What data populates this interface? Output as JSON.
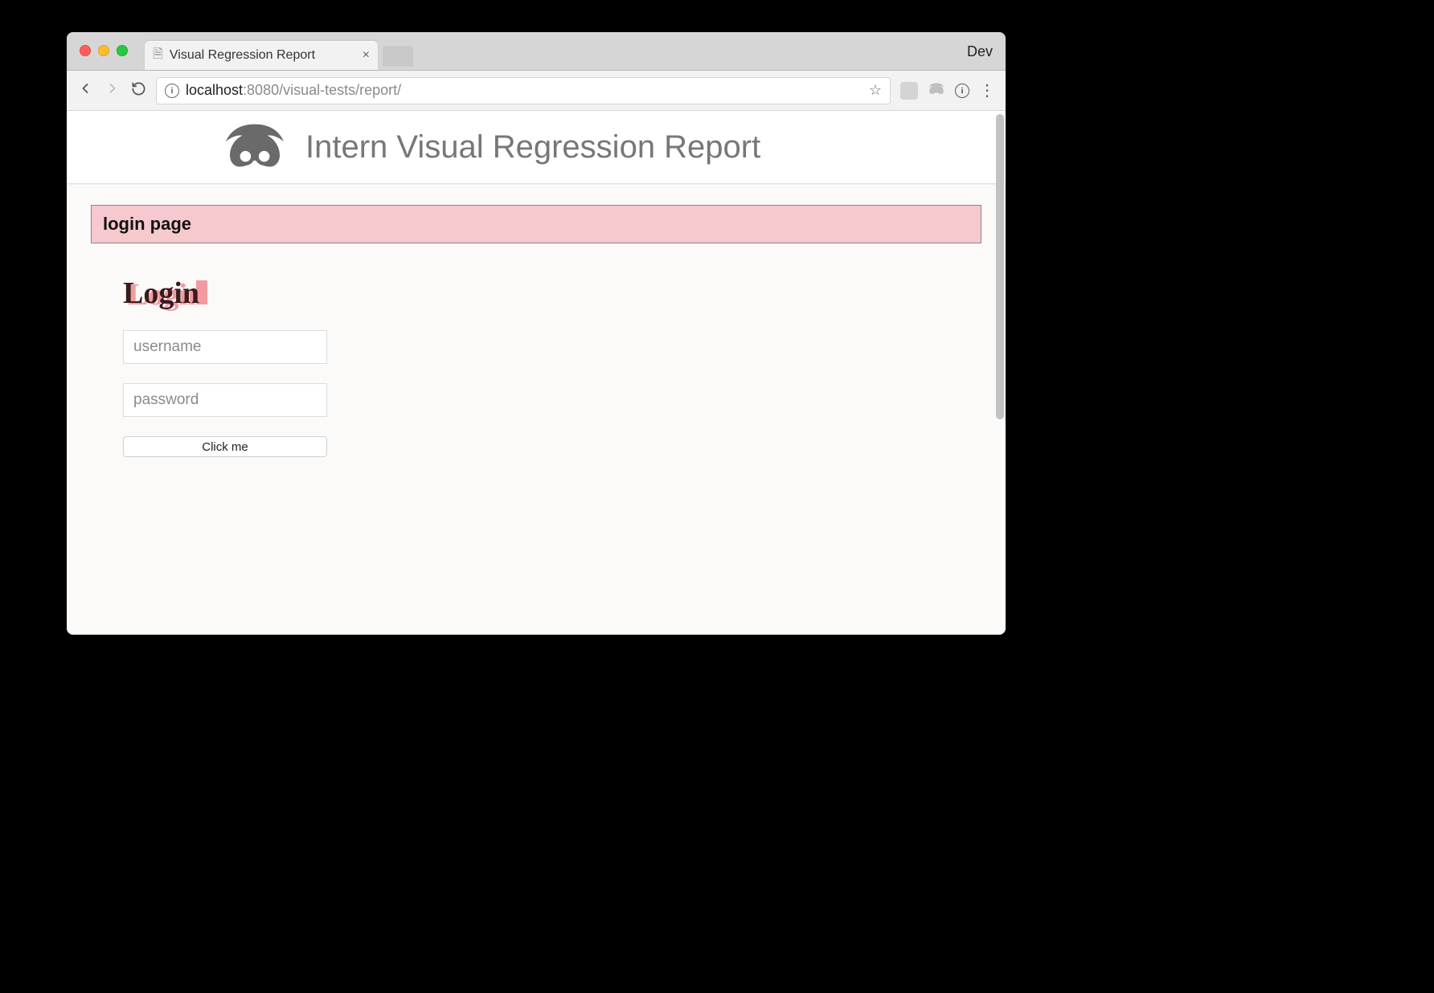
{
  "browser": {
    "tab_title": "Visual Regression Report",
    "dev_label": "Dev",
    "url_info_letter": "i",
    "url_host": "localhost",
    "url_port_path": ":8080/visual-tests/report/"
  },
  "page": {
    "header_title": "Intern Visual Regression Report",
    "test_name": "login page",
    "diff_heading": "Login",
    "username_placeholder": "username",
    "password_placeholder": "password",
    "button_label": "Click me"
  }
}
